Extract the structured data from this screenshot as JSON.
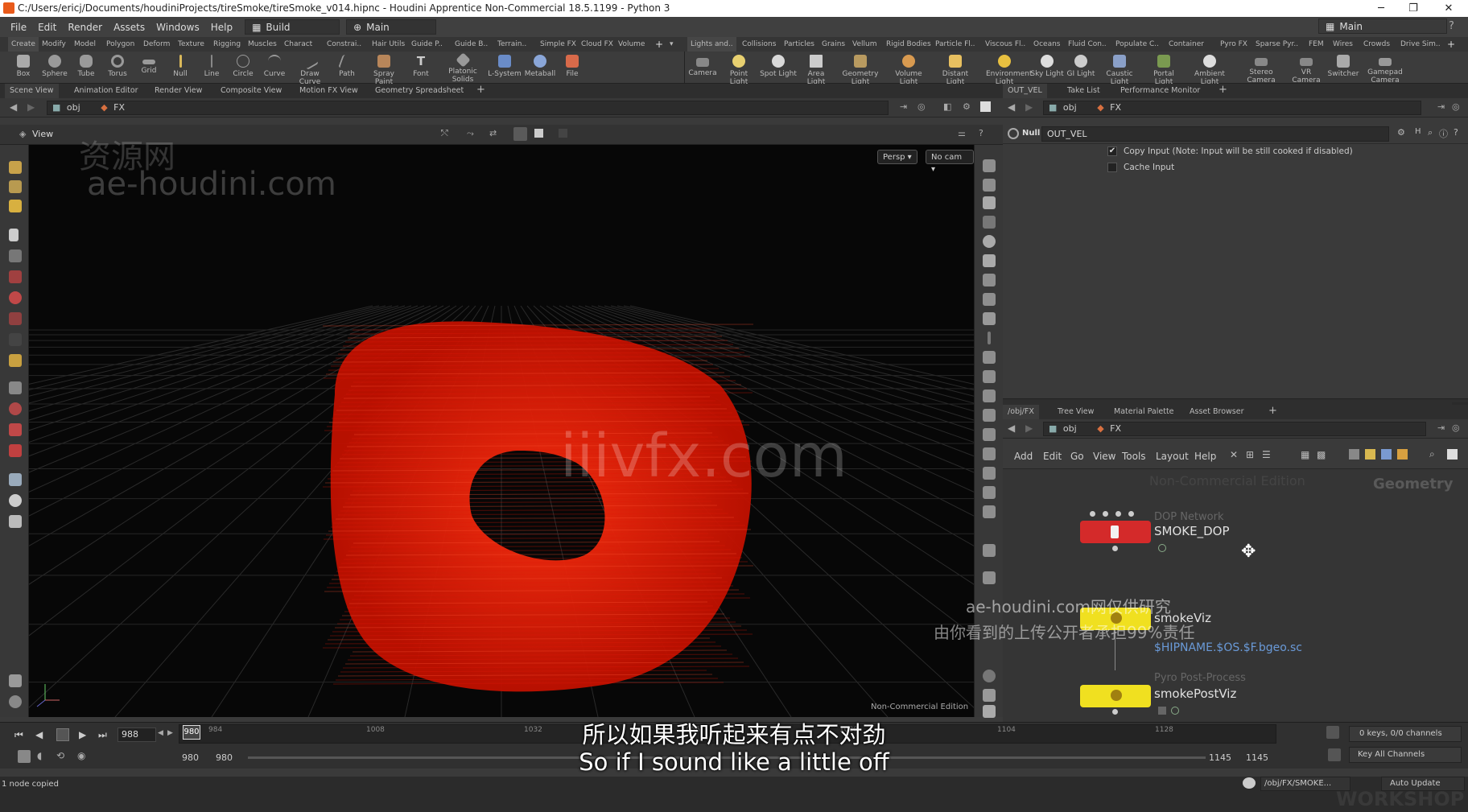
{
  "window": {
    "title": "C:/Users/ericj/Documents/houdiniProjects/tireSmoke/tireSmoke_v014.hipnc - Houdini Apprentice Non-Commercial 18.5.1199 - Python 3",
    "controls": [
      "─",
      "❐",
      "✕"
    ]
  },
  "menubar": {
    "items": [
      "File",
      "Edit",
      "Render",
      "Assets",
      "Windows",
      "Help"
    ],
    "build_dropdown": "Build",
    "main_dropdown": "Main",
    "right_desktop": "Main"
  },
  "shelf_tabs_left": [
    "Create",
    "Modify",
    "Model",
    "Polygon",
    "Deform",
    "Texture",
    "Rigging",
    "Muscles",
    "Charact",
    "Constrai..",
    "Hair Utils",
    "Guide P..",
    "Guide B..",
    "Terrain..",
    "Simple FX",
    "Cloud FX",
    "Volume"
  ],
  "shelf_tabs_right": [
    "Lights and..",
    "Collisions",
    "Particles",
    "Grains",
    "Vellum",
    "Rigid Bodies",
    "Particle Fl..",
    "Viscous Fl..",
    "Oceans",
    "Fluid Con..",
    "Populate C..",
    "Container",
    "Pyro FX",
    "Sparse Pyr..",
    "FEM",
    "Wires",
    "Crowds",
    "Drive Sim.."
  ],
  "shelf_tools_left": [
    "Box",
    "Sphere",
    "Tube",
    "Torus",
    "Grid",
    "Null",
    "Line",
    "Circle",
    "Curve",
    "Draw Curve",
    "Path",
    "Spray Paint",
    "Font",
    "Platonic Solids",
    "L-System",
    "Metaball",
    "File"
  ],
  "shelf_tools_right": [
    "Camera",
    "Point Light",
    "Spot Light",
    "Area Light",
    "Geometry Light",
    "Volume Light",
    "Distant Light",
    "Environment Light",
    "Sky Light",
    "GI Light",
    "Caustic Light",
    "Portal Light",
    "Ambient Light",
    "Stereo Camera",
    "VR Camera",
    "Switcher",
    "Gamepad Camera"
  ],
  "left_pane": {
    "tabs": [
      "Scene View",
      "Animation Editor",
      "Render View",
      "Composite View",
      "Motion FX View",
      "Geometry Spreadsheet"
    ],
    "path": [
      "obj",
      "FX"
    ],
    "view_label": "View",
    "persp_button": "Persp ▾",
    "cam_button": "No cam ▾",
    "edition_label": "Non-Commercial Edition"
  },
  "right_top_pane": {
    "tabs": [
      "OUT_VEL",
      "Take List",
      "Performance Monitor"
    ],
    "path": [
      "obj",
      "FX"
    ],
    "node_type": "Null",
    "node_name": "OUT_VEL",
    "params": [
      {
        "label": "Copy Input (Note: Input will be still cooked if disabled)",
        "checked": true
      },
      {
        "label": "Cache Input",
        "checked": false
      }
    ]
  },
  "network_pane": {
    "tabs": [
      "/obj/FX",
      "Tree View",
      "Material Palette",
      "Asset Browser"
    ],
    "path": [
      "obj",
      "FX"
    ],
    "menu": [
      "Add",
      "Edit",
      "Go",
      "View",
      "Tools",
      "Layout",
      "Help"
    ],
    "edition_watermark": "Non-Commercial Edition",
    "context_label": "Geometry",
    "nodes": [
      {
        "type": "DOP Network",
        "name": "SMOKE_DOP",
        "color": "#d42a2a",
        "extra": ""
      },
      {
        "type": "",
        "name": "smokeViz",
        "color": "#f0e020",
        "extra": "$HIPNAME.$OS.$F.bgeo.sc"
      },
      {
        "type": "Pyro Post-Process",
        "name": "smokePostViz",
        "color": "#f0e020",
        "extra": ""
      }
    ]
  },
  "timeline": {
    "current_frame": "988",
    "frame_marker": "980",
    "ticks": [
      "984",
      "1008",
      "1032",
      "1056",
      "1080",
      "1104",
      "1128"
    ],
    "range_start": "980",
    "range_start2": "980",
    "range_end": "1145",
    "range_end2": "1145",
    "keys_info": "0 keys, 0/0 channels",
    "key_all": "Key All Channels"
  },
  "status": {
    "message": "1 node copied",
    "path": "/obj/FX/SMOKE...",
    "update_mode": "Auto Update"
  },
  "overlays": {
    "watermark_cn": "资源网",
    "watermark_site": "ae-houdini.com",
    "watermark_center": "iiivfx.com",
    "disclaimer_line1": "ae-houdini.com网仅供研究",
    "disclaimer_line2": "由你看到的上传公开者承担99%责任",
    "subtitle_cn": "所以如果我听起来有点不对劲",
    "subtitle_en": "So if I sound like a little off",
    "corner_brand": "WORKSHOP"
  }
}
